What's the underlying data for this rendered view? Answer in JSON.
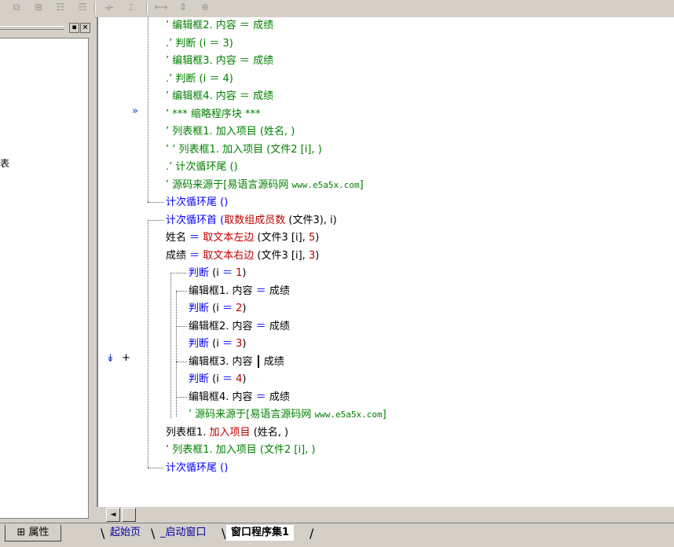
{
  "toolbar": {
    "icons": [
      "align-left-icon",
      "align-center-icon",
      "align-top-icon",
      "align-middle-icon",
      "space-horizontal-icon",
      "space-vertical-icon",
      "same-width-icon",
      "same-height-icon",
      "same-size-icon"
    ],
    "glyphs": [
      "⧉",
      "⊞",
      "☷",
      "☶",
      "⟛",
      "⌶",
      "⟷",
      "⇕",
      "⊕"
    ]
  },
  "left_panel": {
    "pin_glyph": "▪",
    "close_glyph": "×",
    "partial_text": "表"
  },
  "code": {
    "lines": [
      {
        "segments": [
          {
            "t": "’ 编辑框2. 内容 ＝ 成绩",
            "c": "green"
          }
        ]
      },
      {
        "segments": [
          {
            "t": ".’ 判断 (i ＝ 3)",
            "c": "green"
          }
        ]
      },
      {
        "segments": [
          {
            "t": "’ 编辑框3. 内容 ＝ 成绩",
            "c": "green"
          }
        ]
      },
      {
        "segments": [
          {
            "t": ".’ 判断 (i ＝ 4)",
            "c": "green"
          }
        ]
      },
      {
        "segments": [
          {
            "t": "’ 编辑框4. 内容 ＝ 成绩",
            "c": "green"
          }
        ]
      },
      {
        "segments": [
          {
            "t": "’ *** 缩略程序块 ***",
            "c": "green"
          }
        ]
      },
      {
        "segments": [
          {
            "t": "’ 列表框1. 加入项目 (姓名, )",
            "c": "green"
          }
        ]
      },
      {
        "segments": [
          {
            "t": "’ ’ 列表框1. 加入项目 (文件2 [i], )",
            "c": "green"
          }
        ]
      },
      {
        "segments": [
          {
            "t": ".’ 计次循环尾 ()",
            "c": "green"
          }
        ]
      },
      {
        "segments": [
          {
            "t": "’ 源码来源于[易语言源码网 ",
            "c": "green"
          },
          {
            "t": "www.e5a5x.com",
            "c": "green",
            "mono": true
          },
          {
            "t": "]",
            "c": "green"
          }
        ]
      },
      {
        "segments": [
          {
            "t": "计次循环尾 ()",
            "c": "blue"
          }
        ]
      },
      {
        "segments": [
          {
            "t": "计次循环首",
            "c": "blue"
          },
          {
            "t": " (",
            "c": "blue"
          },
          {
            "t": "取数组成员数",
            "c": "red"
          },
          {
            "t": " (文件3), i)",
            "c": "black"
          }
        ]
      },
      {
        "segments": [
          {
            "t": "姓名 ",
            "c": "black"
          },
          {
            "t": "＝ ",
            "c": "blue"
          },
          {
            "t": "取文本左边",
            "c": "red"
          },
          {
            "t": " (文件3 [i], ",
            "c": "black"
          },
          {
            "t": "5",
            "c": "red"
          },
          {
            "t": ")",
            "c": "black"
          }
        ]
      },
      {
        "segments": [
          {
            "t": "成绩 ",
            "c": "black"
          },
          {
            "t": "＝ ",
            "c": "blue"
          },
          {
            "t": "取文本右边",
            "c": "red"
          },
          {
            "t": " (文件3 [i], ",
            "c": "black"
          },
          {
            "t": "3",
            "c": "red"
          },
          {
            "t": ")",
            "c": "black"
          }
        ]
      },
      {
        "segments": [
          {
            "t": "判断",
            "c": "blue"
          },
          {
            "t": " (i ",
            "c": "black"
          },
          {
            "t": "＝ ",
            "c": "blue"
          },
          {
            "t": "1",
            "c": "red"
          },
          {
            "t": ")",
            "c": "black"
          }
        ]
      },
      {
        "segments": [
          {
            "t": "编辑框1. 内容 ",
            "c": "black"
          },
          {
            "t": "＝",
            "c": "blue"
          },
          {
            "t": " 成绩",
            "c": "black"
          }
        ]
      },
      {
        "segments": [
          {
            "t": "判断",
            "c": "blue"
          },
          {
            "t": " (i ",
            "c": "black"
          },
          {
            "t": "＝ ",
            "c": "blue"
          },
          {
            "t": "2",
            "c": "red"
          },
          {
            "t": ")",
            "c": "black"
          }
        ]
      },
      {
        "segments": [
          {
            "t": "编辑框2. 内容 ",
            "c": "black"
          },
          {
            "t": "＝",
            "c": "blue"
          },
          {
            "t": " 成绩",
            "c": "black"
          }
        ]
      },
      {
        "segments": [
          {
            "t": "判断",
            "c": "blue"
          },
          {
            "t": " (i ",
            "c": "black"
          },
          {
            "t": "＝ ",
            "c": "blue"
          },
          {
            "t": "3",
            "c": "red"
          },
          {
            "t": ")",
            "c": "black"
          }
        ]
      },
      {
        "segments": [
          {
            "t": "编辑框3. 内容 ",
            "c": "black"
          },
          {
            "t": "|CURSOR|",
            "c": "cursor"
          },
          {
            "t": " 成绩",
            "c": "black"
          }
        ]
      },
      {
        "segments": [
          {
            "t": "判断",
            "c": "blue"
          },
          {
            "t": " (i ",
            "c": "black"
          },
          {
            "t": "＝ ",
            "c": "blue"
          },
          {
            "t": "4",
            "c": "red"
          },
          {
            "t": ")",
            "c": "black"
          }
        ]
      },
      {
        "segments": [
          {
            "t": "编辑框4. 内容 ",
            "c": "black"
          },
          {
            "t": "＝",
            "c": "blue"
          },
          {
            "t": " 成绩",
            "c": "black"
          }
        ]
      },
      {
        "segments": [
          {
            "t": "’ 源码来源于[易语言源码网 ",
            "c": "green"
          },
          {
            "t": "www.e5a5x.com",
            "c": "green",
            "mono": true
          },
          {
            "t": "]",
            "c": "green"
          }
        ]
      },
      {
        "segments": [
          {
            "t": "列表框1. ",
            "c": "black"
          },
          {
            "t": "加入项目",
            "c": "red"
          },
          {
            "t": " (姓名, )",
            "c": "black"
          }
        ]
      },
      {
        "segments": [
          {
            "t": "’ 列表框1. 加入项目 (文件2 [i], )",
            "c": "green"
          }
        ]
      },
      {
        "segments": [
          {
            "t": "计次循环尾 ()",
            "c": "blue"
          }
        ]
      }
    ],
    "markers": {
      "collapsed_block_glyph": "»",
      "breakpoint_glyph": "↡",
      "expand_glyph": "+"
    }
  },
  "scrollbar": {
    "left_glyph": "◄"
  },
  "bottom": {
    "properties_tab": "属性",
    "properties_icon_glyph": "⊞",
    "tabs": [
      {
        "label": "起始页",
        "active": false
      },
      {
        "label": "_启动窗口",
        "active": false
      },
      {
        "label": "窗口程序集1",
        "active": true
      }
    ]
  }
}
